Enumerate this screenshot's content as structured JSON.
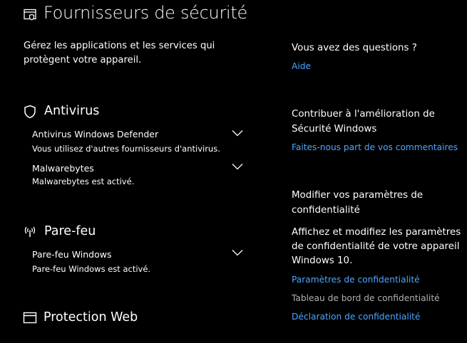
{
  "header": {
    "title": "Fournisseurs de sécurité",
    "icon": "security-providers-icon",
    "intro": "Gérez les applications et les services qui protègent votre appareil."
  },
  "antivirus": {
    "heading": "Antivirus",
    "icon": "shield-icon",
    "items": [
      {
        "name": "Antivirus Windows Defender",
        "status": "Vous utilisez d'autres fournisseurs d'antivirus."
      },
      {
        "name": "Malwarebytes",
        "status": "Malwarebytes est activé."
      }
    ]
  },
  "firewall": {
    "heading": "Pare-feu",
    "icon": "wireless-antenna-icon",
    "items": [
      {
        "name": "Pare-feu Windows",
        "status": "Pare-feu Windows est activé."
      }
    ]
  },
  "web_protection": {
    "heading": "Protection Web",
    "icon": "browser-window-icon"
  },
  "sidebar": {
    "questions_heading": "Vous avez des questions ?",
    "help_link": "Aide",
    "feedback_heading": "Contribuer à l'amélioration de Sécurité Windows",
    "feedback_link": "Faites-nous part de vos commentaires",
    "privacy_heading": "Modifier vos paramètres de confidentialité",
    "privacy_text": "Affichez et modifiez les paramètres de confidentialité de votre appareil Windows 10.",
    "privacy_settings_link": "Paramètres de confidentialité",
    "privacy_dashboard": "Tableau de bord de confidentialité",
    "privacy_statement_link": "Déclaration de confidentialité"
  },
  "colors": {
    "background": "#000000",
    "text": "#ffffff",
    "link": "#4ca6ff",
    "muted": "#b0b0b0"
  }
}
